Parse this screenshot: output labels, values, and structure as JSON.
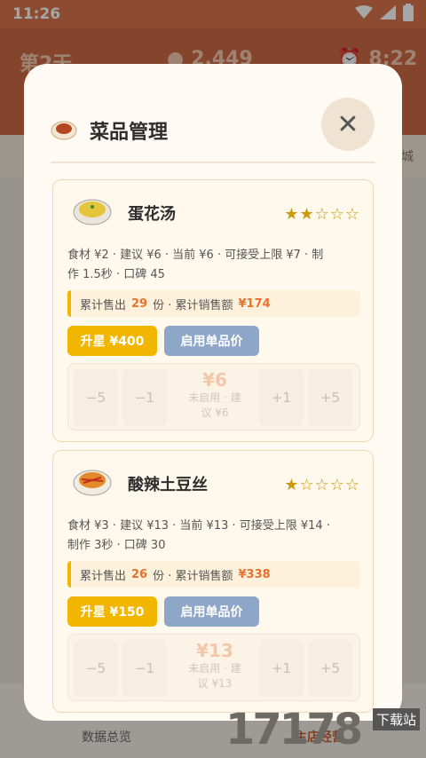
{
  "status_bar": {
    "time": "11:26"
  },
  "top_bar": {
    "day": "第2天",
    "money": "2,449",
    "clock": "8:22"
  },
  "bg_hint": "城",
  "bottom_nav": [
    {
      "label": "数据总览"
    },
    {
      "label": "主店经营"
    }
  ],
  "modal": {
    "title": "菜品管理",
    "close_icon": "close-icon"
  },
  "dishes": [
    {
      "name": "蛋花汤",
      "stars_filled": 2,
      "stars_total": 5,
      "stars": "★★☆☆☆",
      "meta_line1": "食材 ¥2 · 建议 ¥6 · 当前 ¥6 · 可接受上限 ¥7 · 制",
      "meta_line2": "作 1.5秒 · 口碑 45",
      "sales_label1": "累计售出",
      "sales_count": "29",
      "sales_label2": "份 · 累计销售额",
      "sales_amount": "¥174",
      "upgrade_label": "升星 ¥400",
      "price_label": "启用单品价",
      "minus5": "−5",
      "minus1": "−1",
      "price": "¥6",
      "price_sub1": "未启用 · 建",
      "price_sub2": "议 ¥6",
      "plus1": "+1",
      "plus5": "+5"
    },
    {
      "name": "酸辣土豆丝",
      "stars_filled": 1,
      "stars_total": 5,
      "stars": "★☆☆☆☆",
      "meta_line1": "食材 ¥3 · 建议 ¥13 · 当前 ¥13 · 可接受上限 ¥14 ·",
      "meta_line2": "制作 3秒 · 口碑 30",
      "sales_label1": "累计售出",
      "sales_count": "26",
      "sales_label2": "份 · 累计销售额",
      "sales_amount": "¥338",
      "upgrade_label": "升星 ¥150",
      "price_label": "启用单品价",
      "minus5": "−5",
      "minus1": "−1",
      "price": "¥13",
      "price_sub1": "未启用 · 建",
      "price_sub2": "议 ¥13",
      "plus1": "+1",
      "plus5": "+5"
    }
  ],
  "watermark": {
    "text": "17178",
    "tag": "下载站"
  },
  "colors": {
    "accent": "#f2b600",
    "topbar": "#cc6a44",
    "price_button": "#8ea6c8",
    "sales_highlight": "#e8712d"
  }
}
